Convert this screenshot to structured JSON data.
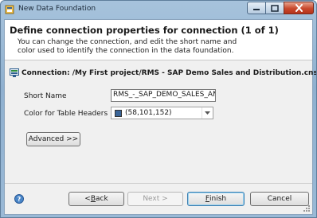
{
  "window": {
    "title": "New Data Foundation"
  },
  "header": {
    "title": "Define connection properties for connection (1 of 1)",
    "description": "You can change the connection, and edit the short name and color used to identify the connection in the data foundation."
  },
  "connection": {
    "label": "Connection: /My First project/RMS - SAP Demo Sales and Distribution.cns"
  },
  "form": {
    "short_name_label": "Short Name",
    "short_name_value": "RMS_-_SAP_DEMO_SALES_AN",
    "color_label": "Color for Table Headers",
    "color_value": "(58,101,152)",
    "color_hex": "#3a6598"
  },
  "buttons": {
    "advanced": "Advanced >>",
    "back_prefix": "< ",
    "back_key": "B",
    "back_rest": "ack",
    "next": "Next >",
    "finish_key": "F",
    "finish_rest": "inish",
    "cancel": "Cancel"
  },
  "icons": {
    "app": "data-foundation-icon",
    "connection": "connection-icon",
    "help": "help-icon",
    "dropdown": "chevron-down-icon"
  }
}
